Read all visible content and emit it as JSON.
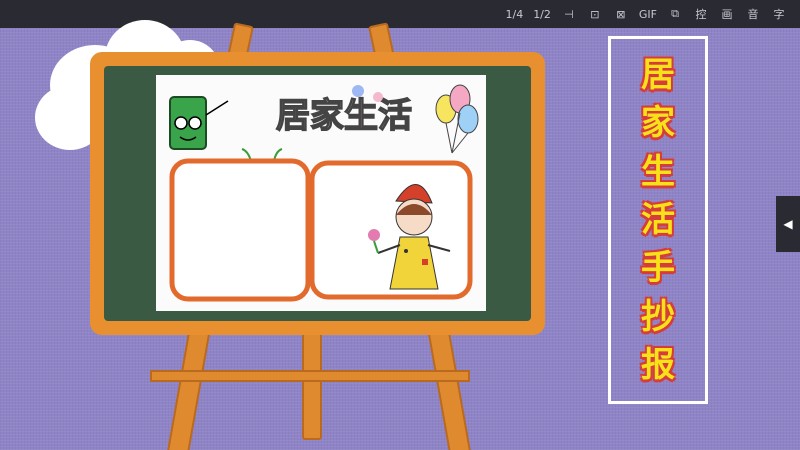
{
  "toolbar": {
    "buttons": [
      {
        "label": "1/4"
      },
      {
        "label": "1/2"
      },
      {
        "label": "⊣"
      },
      {
        "label": "⊡"
      },
      {
        "label": "⊠"
      },
      {
        "label": "GIF"
      },
      {
        "label": "⧉"
      },
      {
        "label": "控"
      },
      {
        "label": "画"
      },
      {
        "label": "音"
      },
      {
        "label": "字"
      }
    ]
  },
  "artwork": {
    "heading": "居家生活"
  },
  "title": {
    "chars": [
      "居",
      "家",
      "生",
      "活",
      "手",
      "抄",
      "报"
    ]
  },
  "side_tab": {
    "icon": "◀"
  }
}
